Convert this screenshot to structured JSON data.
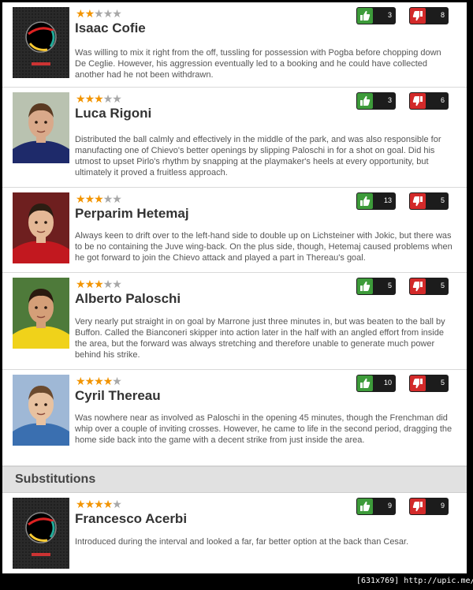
{
  "players": [
    {
      "name": "Isaac Cofie",
      "rating": 2,
      "rating_max": 5,
      "photo": "placeholder-logo",
      "likes": "3",
      "dislikes": "8",
      "text": "Was willing to mix it right from the off, tussling for possession with Pogba before chopping down De Ceglie. However, his aggression eventually led to a booking and he could have collected another had he not been withdrawn."
    },
    {
      "name": "Luca Rigoni",
      "rating": 3,
      "rating_max": 5,
      "photo": "player-photo",
      "likes": "3",
      "dislikes": "6",
      "text": "Distributed the ball calmly and effectively in the middle of the park, and was also responsible for manufacting one of Chievo's better openings by slipping Paloschi in for a shot on goal. Did his utmost to upset Pirlo's rhythm by snapping at the playmaker's heels at every opportunity, but ultimately it proved a fruitless approach."
    },
    {
      "name": "Perparim Hetemaj",
      "rating": 3,
      "rating_max": 5,
      "photo": "player-photo",
      "likes": "13",
      "dislikes": "5",
      "text": "Always keen to drift over to the left-hand side to double up on Lichsteiner with Jokic, but there was to be no containing the Juve wing-back. On the plus side, though, Hetemaj caused problems when he got forward to join the Chievo attack and played a part in Thereau's goal."
    },
    {
      "name": "Alberto Paloschi",
      "rating": 3,
      "rating_max": 5,
      "photo": "player-photo",
      "likes": "5",
      "dislikes": "5",
      "text": "Very nearly put straight in on goal by Marrone just three minutes in, but was beaten to the ball by Buffon. Called the Bianconeri skipper into action later in the half with an angled effort from inside the area, but the forward was always stretching and therefore unable to generate much power behind his strike."
    },
    {
      "name": "Cyril Thereau",
      "rating": 4,
      "rating_max": 5,
      "photo": "player-photo",
      "likes": "10",
      "dislikes": "5",
      "text": "Was nowhere near as involved as Paloschi in the opening 45 minutes, though the Frenchman did whip over a couple of inviting crosses. However, he came to life in the second period, dragging the home side back into the game with a decent strike from just inside the area."
    }
  ],
  "substitutions_label": "Substitutions",
  "substitutes": [
    {
      "name": "Francesco Acerbi",
      "rating": 4,
      "rating_max": 5,
      "photo": "placeholder-logo",
      "likes": "9",
      "dislikes": "9",
      "text": "Introduced during the interval and looked a far, far better option at the back than Cesar."
    }
  ],
  "footer": "[631x769] http://upic.me/",
  "colors": {
    "star_on": "#f29400",
    "star_off": "#a8a8a8",
    "like": "#3d9b3a",
    "dislike": "#d32a2a"
  }
}
